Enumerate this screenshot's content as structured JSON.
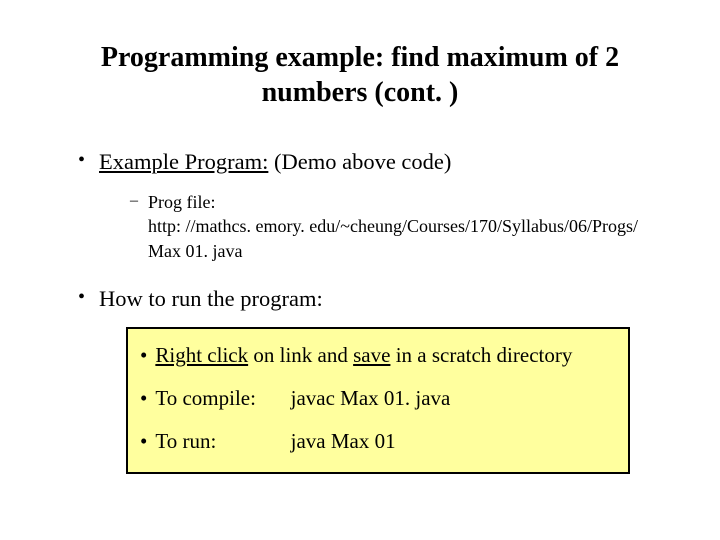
{
  "title": "Programming example: find maximum of 2 numbers (cont. )",
  "bullet1": {
    "label_underlined": "Example Program:",
    "label_rest": " (Demo above code)"
  },
  "sub1": {
    "label": "Prog file:",
    "url": "http: //mathcs. emory. edu/~cheung/Courses/170/Syllabus/06/Progs/ Max 01. java"
  },
  "bullet2": {
    "label": "How to run the program:"
  },
  "box": {
    "line1_a": "Right click",
    "line1_b": " on link and ",
    "line1_c": "save",
    "line1_d": " in a scratch directory",
    "line2_a": "To compile:",
    "line2_b": "javac Max 01. java",
    "line3_a": "To run:",
    "line3_b": "java Max 01"
  }
}
